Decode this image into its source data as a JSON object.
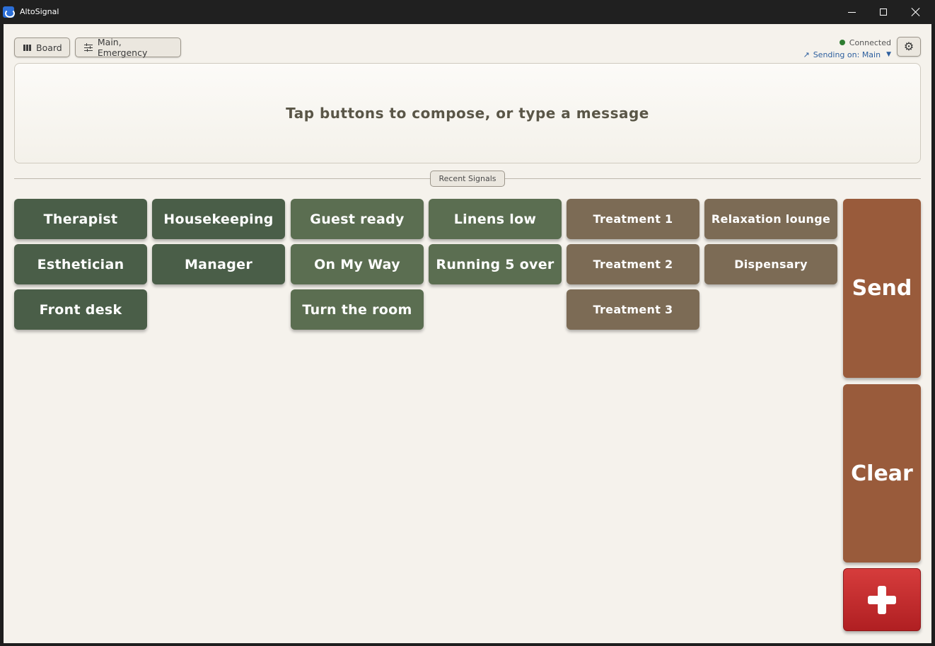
{
  "window": {
    "title": "AltoSignal",
    "icon": "app-logo-icon",
    "controls": [
      "minimize-icon",
      "maximize-icon",
      "close-icon"
    ]
  },
  "toolbar": {
    "board_label": "Board",
    "board_icon": "board-columns-icon",
    "channels_label": "Main, Emergency",
    "channels_icon": "sliders-icon",
    "settings_icon": "gear-icon"
  },
  "status": {
    "connection": "Connected",
    "connection_color": "#2e7d32",
    "sending_label": "Sending on: Main",
    "sending_icon": "arrow-up-right-icon",
    "dropdown_icon": "caret-down-icon"
  },
  "compose": {
    "placeholder": "Tap buttons to compose, or type a message"
  },
  "recent": {
    "label": "Recent Signals"
  },
  "buttons": {
    "therapist": "Therapist",
    "housekeeping": "Housekeeping",
    "guest_ready": "Guest ready",
    "linens_low": "Linens low",
    "treatment_1": "Treatment 1",
    "relaxation_lounge": "Relaxation lounge",
    "esthetician": "Esthetician",
    "manager": "Manager",
    "on_my_way": "On My Way",
    "running_5_over": "Running 5 over",
    "treatment_2": "Treatment 2",
    "dispensary": "Dispensary",
    "front_desk": "Front desk",
    "turn_the_room": "Turn the room",
    "treatment_3": "Treatment 3"
  },
  "actions": {
    "send": "Send",
    "clear": "Clear",
    "emergency_icon": "plus-icon"
  },
  "colors": {
    "people": "#4a5e48",
    "status_msgs": "#5b6e51",
    "locations": "#7c6b55",
    "action": "#995b3b",
    "emergency": "#c62828",
    "background": "#f5f2ec"
  }
}
